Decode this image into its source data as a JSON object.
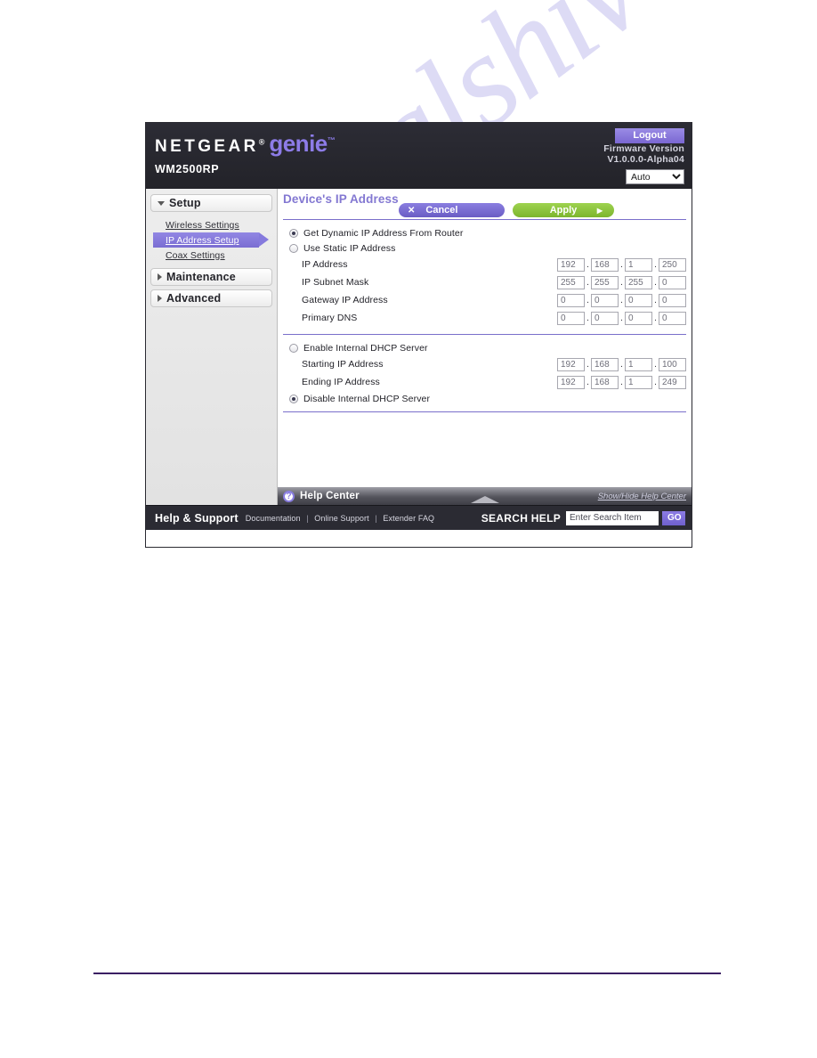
{
  "watermark": {
    "text": "manualshive.com"
  },
  "header": {
    "brand_netgear": "NETGEAR",
    "brand_registered": "®",
    "brand_genie": "genie",
    "brand_tm": "™",
    "model": "WM2500RP",
    "logout_label": "Logout",
    "firmware_label": "Firmware Version",
    "firmware_version": "V1.0.0.0-Alpha04",
    "language_selected": "Auto",
    "language_options": [
      "Auto"
    ]
  },
  "sidebar": {
    "sections": [
      {
        "label": "Setup",
        "expanded": true,
        "items": [
          {
            "label": "Wireless Settings",
            "active": false
          },
          {
            "label": "IP Address Setup",
            "active": true
          },
          {
            "label": "Coax Settings",
            "active": false
          }
        ]
      },
      {
        "label": "Maintenance",
        "expanded": false,
        "items": []
      },
      {
        "label": "Advanced",
        "expanded": false,
        "items": []
      }
    ]
  },
  "main": {
    "title": "Device's IP Address",
    "cancel_label": "Cancel",
    "cancel_icon": "close-x-icon",
    "apply_label": "Apply",
    "apply_icon": "arrow-right-icon",
    "ip_mode": {
      "dynamic_label": "Get Dynamic IP Address From Router",
      "dynamic_selected": true,
      "static_label": "Use Static IP Address",
      "static_selected": false
    },
    "static_fields": [
      {
        "label": "IP Address",
        "octets": [
          "192",
          "168",
          "1",
          "250"
        ]
      },
      {
        "label": "IP Subnet Mask",
        "octets": [
          "255",
          "255",
          "255",
          "0"
        ]
      },
      {
        "label": "Gateway IP Address",
        "octets": [
          "0",
          "0",
          "0",
          "0"
        ]
      },
      {
        "label": "Primary DNS",
        "octets": [
          "0",
          "0",
          "0",
          "0"
        ]
      }
    ],
    "dhcp": {
      "enable_label": "Enable Internal DHCP Server",
      "enable_selected": false,
      "disable_label": "Disable Internal DHCP Server",
      "disable_selected": true,
      "fields": [
        {
          "label": "Starting IP Address",
          "octets": [
            "192",
            "168",
            "1",
            "100"
          ]
        },
        {
          "label": "Ending IP Address",
          "octets": [
            "192",
            "168",
            "1",
            "249"
          ]
        }
      ]
    },
    "dot_separator": "."
  },
  "help_center": {
    "icon": "question-mark-icon",
    "icon_glyph": "?",
    "title": "Help Center",
    "toggle_label": "Show/Hide Help Center",
    "collapse_icon": "chevron-up-icon"
  },
  "support_bar": {
    "title": "Help & Support",
    "links": [
      "Documentation",
      "Online Support",
      "Extender FAQ"
    ],
    "separator": "|",
    "search_label": "SEARCH HELP",
    "search_value": "Enter Search Item",
    "search_placeholder": "Enter Search Item",
    "go_label": "GO"
  },
  "colors": {
    "accent_purple": "#8d7ce8",
    "apply_green": "#8cc63f",
    "header_dark": "#26262e",
    "watermark": "#c9c6ef"
  }
}
